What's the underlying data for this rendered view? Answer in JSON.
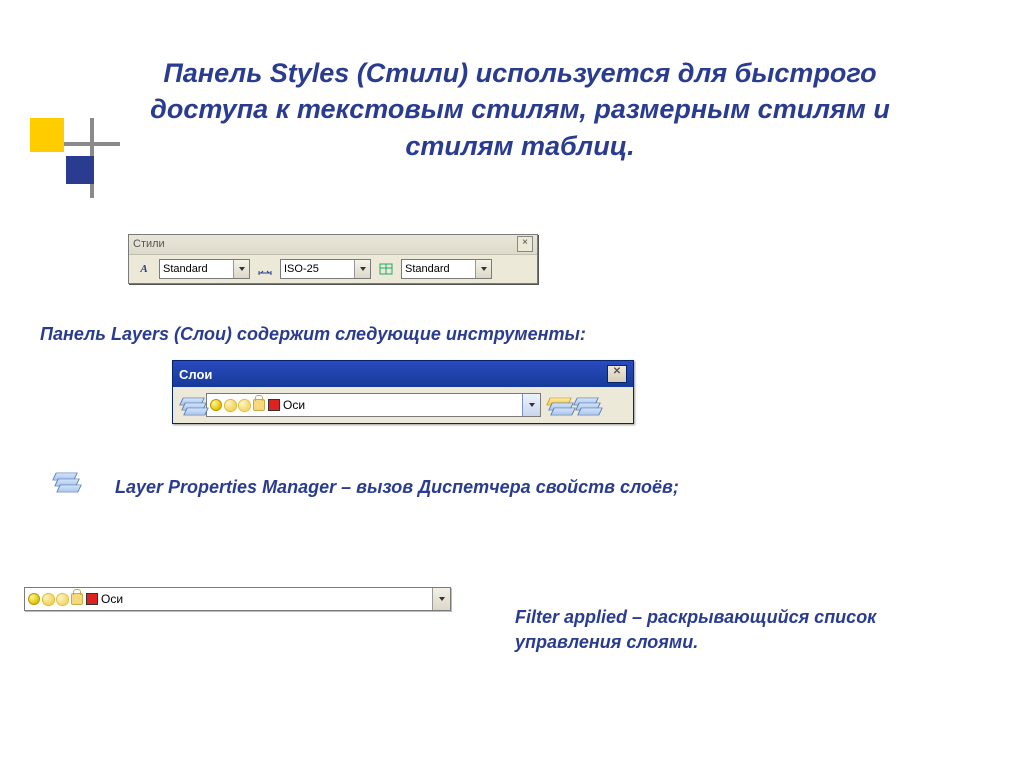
{
  "title": "Панель Styles (Стили) используется для быстрого доступа к текстовым стилям, размерным стилям  и стилям таблиц.",
  "sub1": "Панель Layers (Слои)  содержит следующие      инструменты:",
  "sub2": "Layer Properties Manager – вызов Диспетчера свойств слоёв;",
  "sub3": "Filter applied – раскрывающийся список управления слоями.",
  "stylesToolbar": {
    "title": "Стили",
    "textStyle": "Standard",
    "dimStyle": "ISO-25",
    "tableStyle": "Standard"
  },
  "layersToolbar": {
    "title": "Слои",
    "currentLayer": "Оси"
  },
  "filterCombo": {
    "currentLayer": "Оси"
  }
}
